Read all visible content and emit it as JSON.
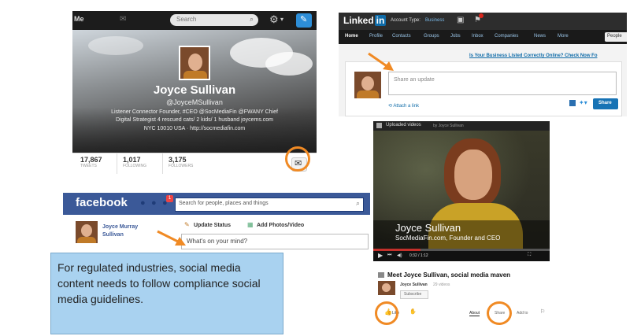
{
  "twitter": {
    "logo_text": "Me",
    "search_placeholder": "Search",
    "gear": "⚙",
    "gear_caret": "▾",
    "name": "Joyce Sullivan",
    "handle": "@JoyceMSullivan",
    "bio_line1": "Listener Connector Founder, #CEO @SocMediaFin @FWANY Chief",
    "bio_line2": "Digital Strategist 4 rescued cats/ 2 kids/ 1 husband joycems.com",
    "location_url": "NYC 10010 USA · http://socmediafin.com",
    "stats": [
      {
        "value": "17,867",
        "label": "TWEETS"
      },
      {
        "value": "1,017",
        "label": "FOLLOWING"
      },
      {
        "value": "3,175",
        "label": "FOLLOWERS"
      }
    ]
  },
  "linkedin": {
    "logo_text": "Linked",
    "logo_in": "in",
    "account_type_label": "Account Type:",
    "account_type_value": "Business",
    "nav": [
      "Home",
      "Profile",
      "Contacts",
      "Groups",
      "Jobs",
      "Inbox",
      "Companies",
      "News",
      "More"
    ],
    "people_button": "People",
    "promo_link": "Is Your Business Listed Correctly Online? Check Now Fo",
    "share_placeholder": "Share an update",
    "attach_link": "Attach a link",
    "share_button": "Share"
  },
  "video": {
    "header": "Uploaded videos",
    "header_by": "by Joyce Sullivan",
    "overlay_name": "Joyce Sullivan",
    "overlay_sub": "SocMediaFin.com, Founder and CEO",
    "time": "0:32 / 1:12",
    "title": "Meet Joyce Sullivan, social media maven",
    "channel": "Joyce Sullivan",
    "channel_count": "29 videos",
    "subscribe": "Subscribe",
    "like": "Like",
    "tabs": [
      "About",
      "Share",
      "Add to"
    ]
  },
  "facebook": {
    "logo": "facebook",
    "notif_count": "1",
    "search_placeholder": "Search for people, places and things",
    "user_name_line1": "Joyce Murray",
    "user_name_line2": "Sullivan",
    "update_status": "Update Status",
    "add_photos": "Add Photos/Video",
    "whats_on_mind": "What's on your mind?"
  },
  "caption": {
    "text": "For regulated industries, social media content needs to follow compliance social media guidelines."
  },
  "colors": {
    "accent_orange": "#f08a24",
    "twitter_blue": "#2d8ed8",
    "linkedin_blue": "#0e6ba8",
    "facebook_blue": "#3b5998",
    "caption_bg": "#a9d2f0"
  }
}
